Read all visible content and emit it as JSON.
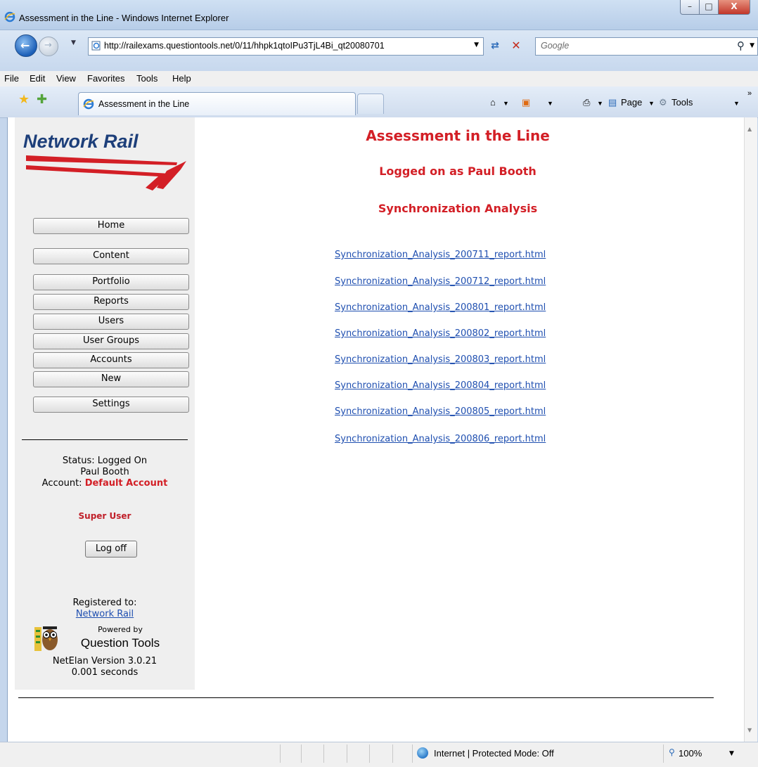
{
  "window": {
    "title": "Assessment in the Line - Windows Internet Explorer",
    "min_glyph": "–",
    "max_glyph": "□",
    "close_glyph": "X"
  },
  "address": {
    "url": "http://railexams.questiontools.net/0/11/hhpk1qtoIPu3TjL4Bi_qt20080701",
    "search_placeholder": "Google"
  },
  "menu": [
    "File",
    "Edit",
    "View",
    "Favorites",
    "Tools",
    "Help"
  ],
  "tabs": {
    "active_label": "Assessment in the Line"
  },
  "commands": {
    "page": "Page",
    "tools": "Tools"
  },
  "sidebar": {
    "brand": "Network Rail",
    "nav": [
      "Home",
      "Content",
      "Portfolio",
      "Reports",
      "Users",
      "User Groups",
      "Accounts",
      "New",
      "Settings"
    ],
    "status": "Status: Logged On",
    "user": "Paul Booth",
    "account_label": "Account: ",
    "account_value": "Default Account",
    "role": "Super User",
    "logoff": "Log off",
    "registered_label": "Registered to:",
    "registered_link": "Network Rail",
    "powered_by": "Powered by",
    "product": "Question Tools",
    "version": "NetElan Version 3.0.21",
    "timing": "0.001 seconds"
  },
  "main": {
    "title": "Assessment in the Line",
    "logged_on": "Logged on as Paul Booth",
    "section": "Synchronization Analysis",
    "reports": [
      "Synchronization_Analysis_200711_report.html",
      "Synchronization_Analysis_200712_report.html",
      "Synchronization_Analysis_200801_report.html",
      "Synchronization_Analysis_200802_report.html",
      "Synchronization_Analysis_200803_report.html",
      "Synchronization_Analysis_200804_report.html",
      "Synchronization_Analysis_200805_report.html",
      "Synchronization_Analysis_200806_report.html"
    ]
  },
  "statusbar": {
    "zone": "Internet | Protected Mode: Off",
    "zoom": "100%"
  },
  "colors": {
    "brand_red": "#d31f26",
    "brand_blue": "#1d3f7a",
    "link": "#1f4fb0"
  }
}
